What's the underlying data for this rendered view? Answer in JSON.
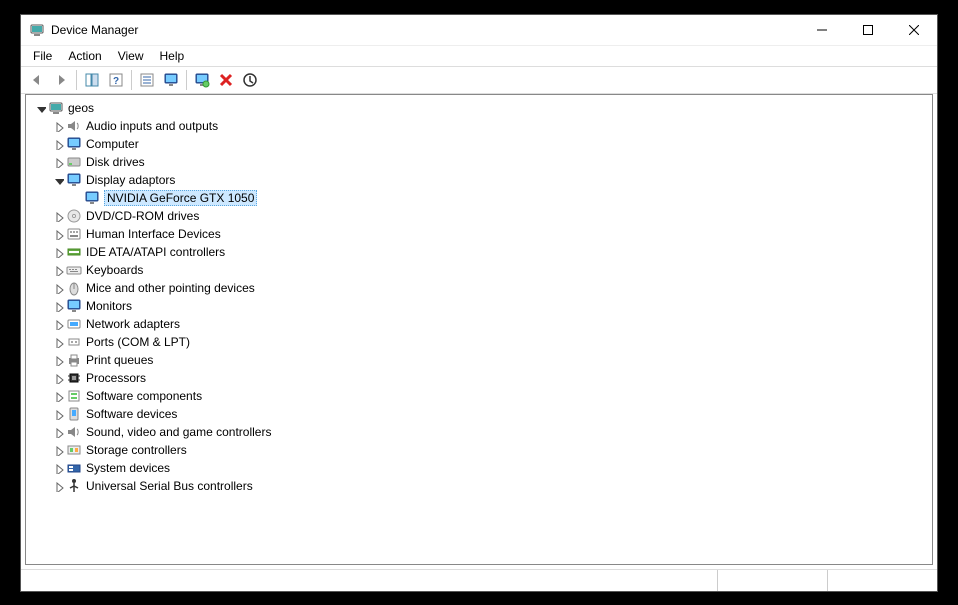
{
  "window": {
    "title": "Device Manager"
  },
  "menu": {
    "file": "File",
    "action": "Action",
    "view": "View",
    "help": "Help"
  },
  "toolbar_icons": {
    "back": "back-arrow-icon",
    "forward": "forward-arrow-icon",
    "show_hide": "show-hide-tree-icon",
    "help": "help-icon",
    "properties": "properties-icon",
    "update": "update-driver-icon",
    "scan": "scan-hardware-icon",
    "add": "add-hardware-icon",
    "uninstall": "uninstall-icon",
    "enable": "enable-device-icon"
  },
  "tree": {
    "root": {
      "label": "geos",
      "icon": "computer-icon"
    },
    "categories": [
      {
        "label": "Audio inputs and outputs",
        "icon": "speaker-icon",
        "expanded": false
      },
      {
        "label": "Computer",
        "icon": "monitor-icon",
        "expanded": false
      },
      {
        "label": "Disk drives",
        "icon": "disk-icon",
        "expanded": false
      },
      {
        "label": "Display adaptors",
        "icon": "monitor-icon",
        "expanded": true,
        "children": [
          {
            "label": "NVIDIA GeForce GTX 1050",
            "icon": "monitor-icon",
            "selected": true
          }
        ]
      },
      {
        "label": "DVD/CD-ROM drives",
        "icon": "optical-icon",
        "expanded": false
      },
      {
        "label": "Human Interface Devices",
        "icon": "hid-icon",
        "expanded": false
      },
      {
        "label": "IDE ATA/ATAPI controllers",
        "icon": "ide-icon",
        "expanded": false
      },
      {
        "label": "Keyboards",
        "icon": "keyboard-icon",
        "expanded": false
      },
      {
        "label": "Mice and other pointing devices",
        "icon": "mouse-icon",
        "expanded": false
      },
      {
        "label": "Monitors",
        "icon": "monitor-icon",
        "expanded": false
      },
      {
        "label": "Network adapters",
        "icon": "network-icon",
        "expanded": false
      },
      {
        "label": "Ports (COM & LPT)",
        "icon": "port-icon",
        "expanded": false
      },
      {
        "label": "Print queues",
        "icon": "printer-icon",
        "expanded": false
      },
      {
        "label": "Processors",
        "icon": "cpu-icon",
        "expanded": false
      },
      {
        "label": "Software components",
        "icon": "software-component-icon",
        "expanded": false
      },
      {
        "label": "Software devices",
        "icon": "software-device-icon",
        "expanded": false
      },
      {
        "label": "Sound, video and game controllers",
        "icon": "speaker-icon",
        "expanded": false
      },
      {
        "label": "Storage controllers",
        "icon": "storage-icon",
        "expanded": false
      },
      {
        "label": "System devices",
        "icon": "system-icon",
        "expanded": false
      },
      {
        "label": "Universal Serial Bus controllers",
        "icon": "usb-icon",
        "expanded": false
      }
    ]
  }
}
